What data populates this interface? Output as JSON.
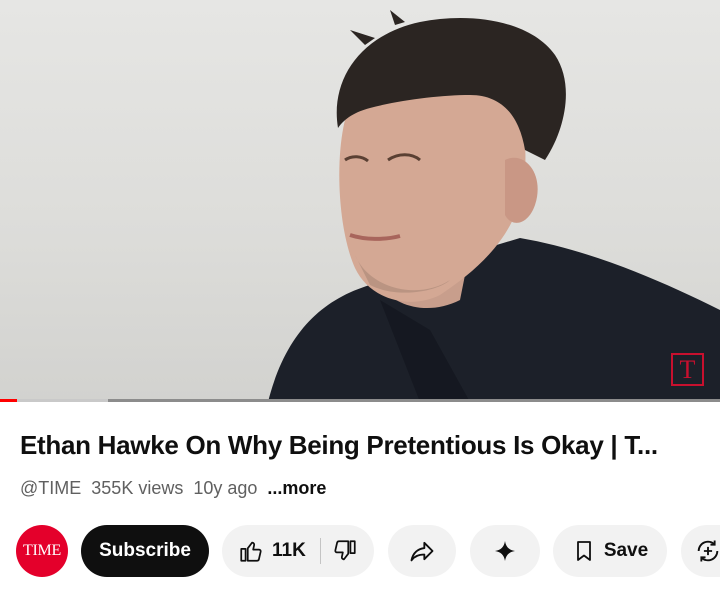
{
  "video": {
    "channel_logo_letter": "T",
    "progress_played": 0.024,
    "progress_buffered": 0.15
  },
  "title": "Ethan Hawke On Why Being Pretentious Is Okay | T...",
  "meta": {
    "channel_handle": "@TIME",
    "views": "355K views",
    "age": "10y ago",
    "more": "...more"
  },
  "actions": {
    "channel_avatar_text": "TIME",
    "subscribe_label": "Subscribe",
    "like_count": "11K",
    "save_label": "Save"
  },
  "colors": {
    "brand_red": "#e4002b",
    "progress_red": "#ff0000",
    "subscribe_bg": "#0f0f0f",
    "pill_bg": "#f2f2f2"
  },
  "icons": [
    "like-icon",
    "dislike-icon",
    "share-icon",
    "sparkle-icon",
    "save-icon",
    "remix-icon"
  ]
}
